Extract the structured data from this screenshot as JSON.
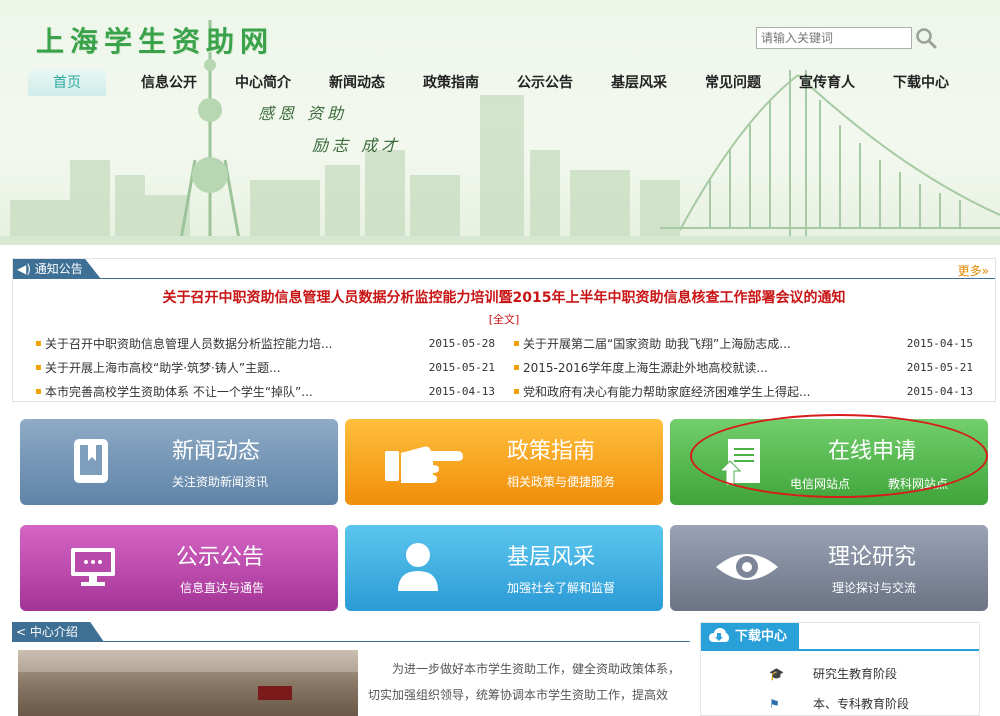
{
  "header": {
    "logo": "上海学生资助网",
    "slogan_line1": "感恩 资助",
    "slogan_line2": "励志 成才",
    "search_placeholder": "请输入关键词"
  },
  "nav": [
    "首页",
    "信息公开",
    "中心简介",
    "新闻动态",
    "政策指南",
    "公示公告",
    "基层风采",
    "常见问题",
    "宣传育人",
    "下载中心"
  ],
  "notice": {
    "tab": "通知公告",
    "more": "更多»",
    "headline": "关于召开中职资助信息管理人员数据分析监控能力培训暨2015年上半年中职资助信息核查工作部署会议的通知",
    "fulltext": "[全文]",
    "left": [
      {
        "title": "关于召开中职资助信息管理人员数据分析监控能力培...",
        "date": "2015-05-28"
      },
      {
        "title": "关于开展上海市高校“助学·筑梦·铸人”主题...",
        "date": "2015-05-21"
      },
      {
        "title": "本市完善高校学生资助体系 不让一个学生“掉队”...",
        "date": "2015-04-13"
      }
    ],
    "right": [
      {
        "title": "关于开展第二届“国家资助 助我飞翔”上海励志成...",
        "date": "2015-04-15"
      },
      {
        "title": "2015-2016学年度上海生源赴外地高校就读...",
        "date": "2015-05-21"
      },
      {
        "title": "党和政府有决心有能力帮助家庭经济困难学生上得起...",
        "date": "2015-04-13"
      }
    ]
  },
  "tiles": {
    "news": {
      "title": "新闻动态",
      "sub": "关注资助新闻资讯"
    },
    "policy": {
      "title": "政策指南",
      "sub": "相关政策与便捷服务"
    },
    "apply": {
      "title": "在线申请",
      "sub1": "电信网站点",
      "sub2": "教科网站点"
    },
    "notice": {
      "title": "公示公告",
      "sub": "信息直达与通告"
    },
    "grassroots": {
      "title": "基层风采",
      "sub": "加强社会了解和监督"
    },
    "research": {
      "title": "理论研究",
      "sub": "理论探讨与交流"
    }
  },
  "intro": {
    "tab": "中心介绍",
    "text": "为进一步做好本市学生资助工作，健全资助政策体系，切实加强组织领导，统筹协调本市学生资助工作，提高效"
  },
  "download": {
    "title": "下载中心",
    "items": [
      "研究生教育阶段",
      "本、专科教育阶段"
    ]
  },
  "colors": {
    "accent": "#3e6f95",
    "headline": "#c81414",
    "logo": "#3aa24a",
    "download": "#2aa0d8"
  }
}
